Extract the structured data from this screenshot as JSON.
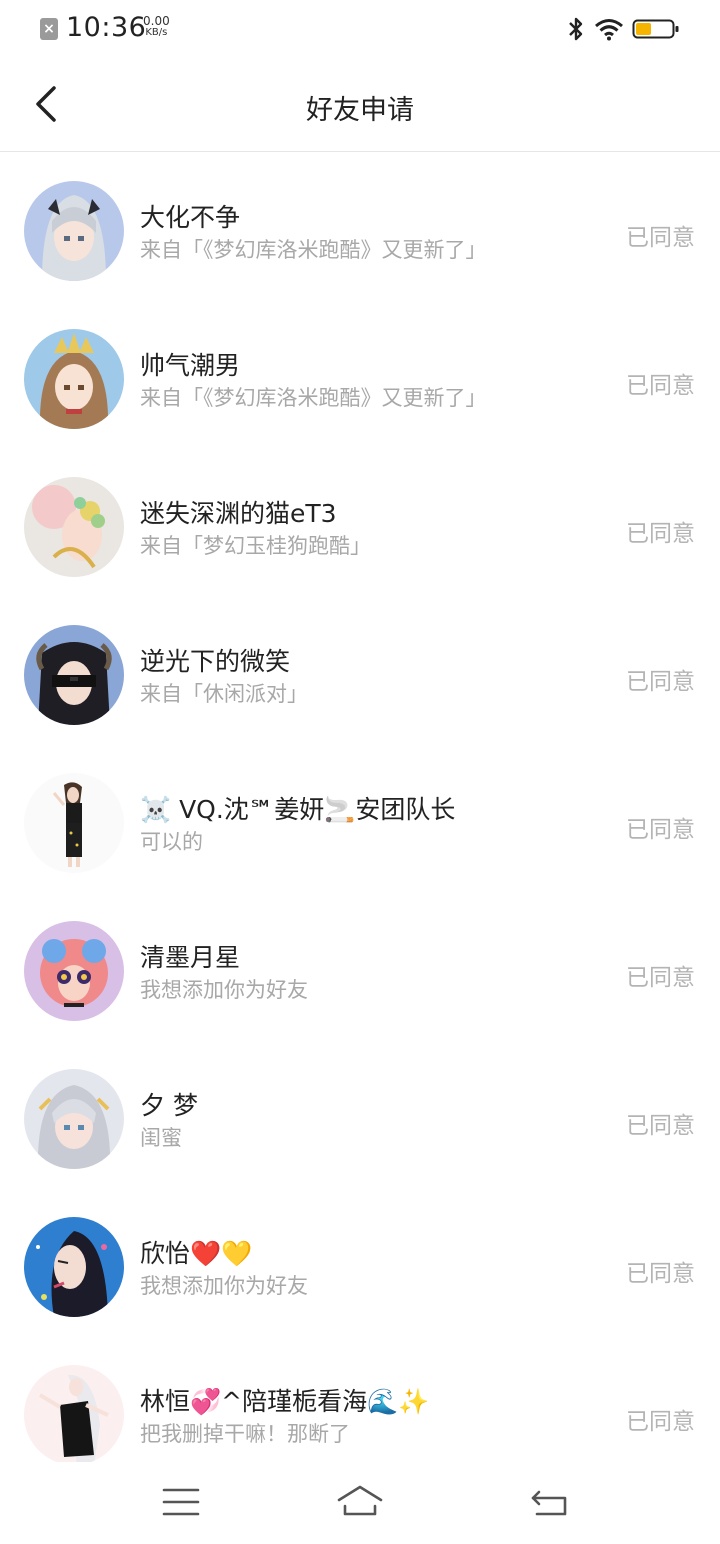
{
  "status_bar": {
    "time": "10:36",
    "net_speed_value": "0.00",
    "net_speed_unit": "KB/s",
    "notification_icon": "close-box-icon",
    "icons": [
      "bluetooth-icon",
      "wifi-icon",
      "battery-icon"
    ],
    "battery_color": "#f5b400"
  },
  "header": {
    "title": "好友申请",
    "back_icon": "chevron-left-icon"
  },
  "requests": [
    {
      "name": "大化不争",
      "source": "来自「《梦幻库洛米跑酷》又更新了」",
      "status": "已同意"
    },
    {
      "name": "帅气潮男",
      "source": "来自「《梦幻库洛米跑酷》又更新了」",
      "status": "已同意"
    },
    {
      "name": "迷失深渊的猫eT3",
      "source": "来自「梦幻玉桂狗跑酷」",
      "status": "已同意"
    },
    {
      "name": "逆光下的微笑",
      "source": "来自「休闲派对」",
      "status": "已同意"
    },
    {
      "name": "☠️ VQ.沈℠姜妍🚬安团队长",
      "source": "可以的",
      "status": "已同意"
    },
    {
      "name": "清墨月星",
      "source": "我想添加你为好友",
      "status": "已同意"
    },
    {
      "name": "夕 梦",
      "source": "闺蜜",
      "status": "已同意"
    },
    {
      "name": "欣怡❤️💛",
      "source": "我想添加你为好友",
      "status": "已同意"
    },
    {
      "name": "林恒💞^陪瑾栀看海🌊✨",
      "source": "把我删掉干嘛！那断了",
      "status": "已同意"
    }
  ],
  "nav_bar": {
    "icons": [
      "menu-icon",
      "home-icon",
      "back-icon"
    ]
  },
  "colors": {
    "accent_status": "#b4b4b4",
    "subtitle": "#a8a8a8",
    "divider": "#e6e6e6"
  }
}
